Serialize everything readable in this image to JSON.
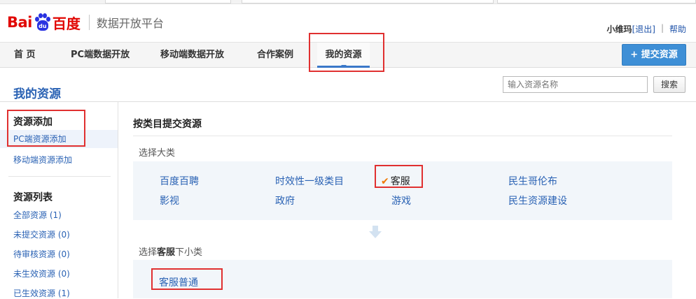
{
  "brand": {
    "logo_latin": "Bai",
    "logo_paw_text": "du",
    "logo_cn": "百度",
    "platform": "数据开放平台"
  },
  "user": {
    "name": "小维玛",
    "logout": "[退出]",
    "help": "帮助"
  },
  "nav": {
    "items": [
      "首 页",
      "PC端数据开放",
      "移动端数据开放",
      "合作案例",
      "我的资源"
    ],
    "submit_label": "+ 提交资源"
  },
  "page": {
    "title": "我的资源"
  },
  "search": {
    "placeholder": "输入资源名称",
    "button": "搜索"
  },
  "sidebar": {
    "add_heading": "资源添加",
    "add_items": [
      "PC端资源添加",
      "移动端资源添加"
    ],
    "list_heading": "资源列表",
    "list_items": [
      "全部资源 (1)",
      "未提交资源 (0)",
      "待审核资源 (0)",
      "未生效资源 (0)",
      "已生效资源 (1)"
    ]
  },
  "main": {
    "title": "按类目提交资源",
    "big_category_label": "选择大类",
    "categories_row1": [
      "百度百聘",
      "时效性一级类目",
      "客服",
      "民生哥伦布"
    ],
    "categories_row2": [
      "影视",
      "政府",
      "游戏",
      "民生资源建设"
    ],
    "check_mark": "✔",
    "sub_label_prefix": "选择",
    "sub_label_category": "客服",
    "sub_label_suffix": "下小类",
    "subcategories": [
      "客服普通"
    ]
  },
  "colors": {
    "accent": "#2a62b4",
    "brand_red": "#e10602",
    "highlight_box": "#e03030",
    "button_blue": "#3e8fd6",
    "check_orange": "#f07800"
  }
}
